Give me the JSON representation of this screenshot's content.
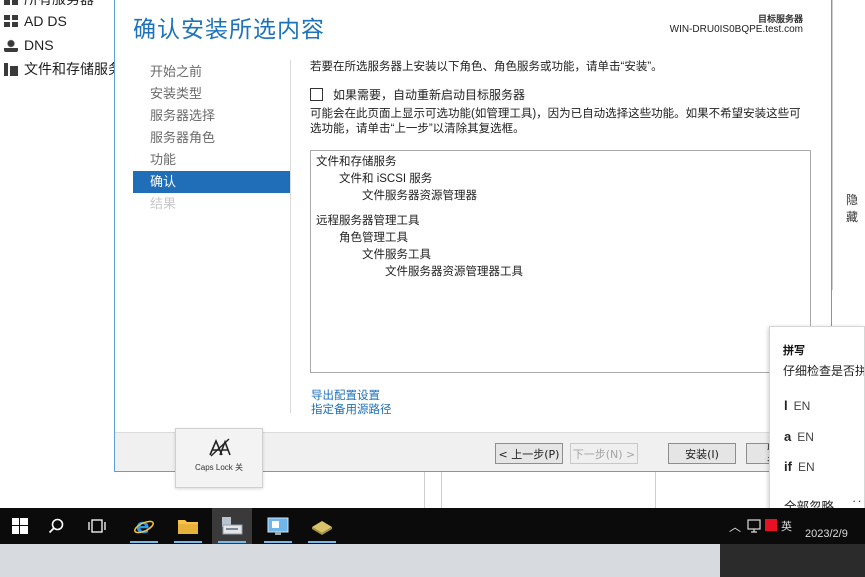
{
  "server_manager": {
    "nav_items": [
      {
        "label": "所有服务器",
        "icon": "servers-icon"
      },
      {
        "label": "AD DS",
        "icon": "ad-ds-icon"
      },
      {
        "label": "DNS",
        "icon": "dns-icon"
      },
      {
        "label": "文件和存储服务",
        "icon": "file-storage-icon"
      }
    ],
    "right_pane_label": "隐藏"
  },
  "wizard": {
    "title": "确认安装所选内容",
    "destination_label": "目标服务器",
    "destination_server": "WIN-DRU0IS0BQPE.test.com",
    "steps": [
      {
        "label": "开始之前",
        "state": "normal"
      },
      {
        "label": "安装类型",
        "state": "normal"
      },
      {
        "label": "服务器选择",
        "state": "normal"
      },
      {
        "label": "服务器角色",
        "state": "normal"
      },
      {
        "label": "功能",
        "state": "normal"
      },
      {
        "label": "确认",
        "state": "active"
      },
      {
        "label": "结果",
        "state": "disabled"
      }
    ],
    "intro_text": "若要在所选服务器上安装以下角色、角色服务或功能，请单击“安装”。",
    "restart_checkbox": {
      "label": "如果需要，自动重新启动目标服务器",
      "checked": false
    },
    "note_text": "可能会在此页面上显示可选功能(如管理工具)，因为已自动选择这些功能。如果不希望安装这些可选功能，请单击“上一步”以清除其复选框。",
    "features": [
      {
        "text": "文件和存储服务",
        "level": 0
      },
      {
        "text": "文件和 iSCSI 服务",
        "level": 1
      },
      {
        "text": "文件服务器资源管理器",
        "level": 2
      },
      {
        "text": "",
        "level": -1
      },
      {
        "text": "远程服务器管理工具",
        "level": 0
      },
      {
        "text": "角色管理工具",
        "level": 1
      },
      {
        "text": "文件服务工具",
        "level": 2
      },
      {
        "text": "文件服务器资源管理器工具",
        "level": 3
      }
    ],
    "link_export": "导出配置设置",
    "link_source": "指定备用源路径",
    "buttons": {
      "prev": "< 上一步(P)",
      "next": "下一步(N) >",
      "install": "安装(I)",
      "cancel": "取消"
    }
  },
  "capslock_popup": {
    "label": "Caps Lock 关",
    "icon": "caps-lock-off-icon"
  },
  "spelling_popup": {
    "title": "拼写",
    "description": "仔细检查是否拼",
    "suggestions": [
      {
        "word": "l",
        "lang": "EN"
      },
      {
        "word": "a",
        "lang": "EN"
      },
      {
        "word": "if",
        "lang": "EN"
      }
    ],
    "ignore_all": "全部忽略",
    "more": "··"
  },
  "taskbar": {
    "apps": [
      {
        "name": "start-icon",
        "running": false,
        "active": false
      },
      {
        "name": "search-icon",
        "running": false,
        "active": false
      },
      {
        "name": "task-view-icon",
        "running": false,
        "active": false
      },
      {
        "name": "internet-explorer-icon",
        "running": true,
        "active": false
      },
      {
        "name": "file-explorer-icon",
        "running": true,
        "active": false
      },
      {
        "name": "server-manager-icon",
        "running": true,
        "active": true
      },
      {
        "name": "remote-desktop-icon",
        "running": true,
        "active": false
      },
      {
        "name": "storage-app-icon",
        "running": true,
        "active": false
      }
    ],
    "tray_date": "2023/2/9",
    "tray_lang": "英"
  },
  "colors": {
    "accent": "#1f6eb7",
    "title": "#1e73b8",
    "link": "#1e6fb8",
    "taskbar": "#0b0b0b"
  }
}
